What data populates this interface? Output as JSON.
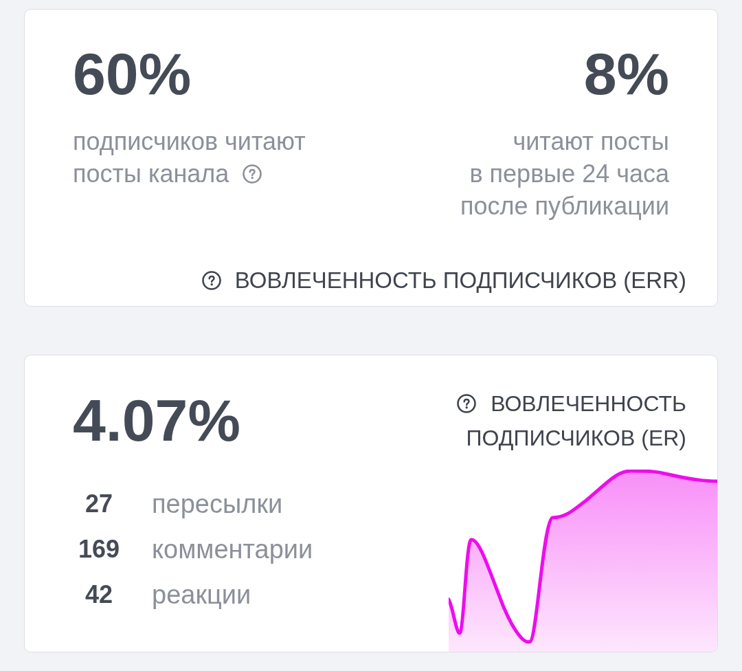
{
  "err_card": {
    "stats": [
      {
        "value": "60%",
        "caption_lines": [
          "подписчиков читают",
          "посты канала"
        ],
        "help_icon": true
      },
      {
        "value": "8%",
        "caption_lines": [
          "читают посты",
          "в первые 24 часа",
          "после публикации"
        ],
        "help_icon": false
      }
    ],
    "footer": "ВОВЛЕЧЕННОСТЬ ПОДПИСЧИКОВ (ERR)"
  },
  "er_card": {
    "value": "4.07%",
    "title_lines": [
      "ВОВЛЕЧЕННОСТЬ",
      "ПОДПИСЧИКОВ (ER)"
    ],
    "metrics": [
      {
        "count": "27",
        "label": "пересылки"
      },
      {
        "count": "169",
        "label": "комментарии"
      },
      {
        "count": "42",
        "label": "реакции"
      }
    ]
  }
}
